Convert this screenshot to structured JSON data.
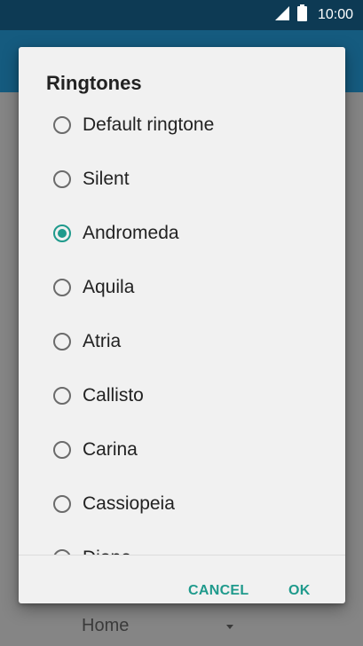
{
  "status_bar": {
    "time": "10:00"
  },
  "behind": {
    "field_text": "Home"
  },
  "dialog": {
    "title": "Ringtones",
    "options": [
      {
        "label": "Default ringtone",
        "checked": false
      },
      {
        "label": "Silent",
        "checked": false
      },
      {
        "label": "Andromeda",
        "checked": true
      },
      {
        "label": "Aquila",
        "checked": false
      },
      {
        "label": "Atria",
        "checked": false
      },
      {
        "label": "Callisto",
        "checked": false
      },
      {
        "label": "Carina",
        "checked": false
      },
      {
        "label": "Cassiopeia",
        "checked": false
      },
      {
        "label": "Dione",
        "checked": false
      }
    ],
    "cancel_label": "CANCEL",
    "ok_label": "OK"
  },
  "colors": {
    "accent": "#1f9a8c",
    "status_bar": "#0d3a54",
    "app_bar": "#155b7f"
  },
  "icons": {
    "signal": "cellular-signal-icon",
    "battery": "battery-icon"
  }
}
